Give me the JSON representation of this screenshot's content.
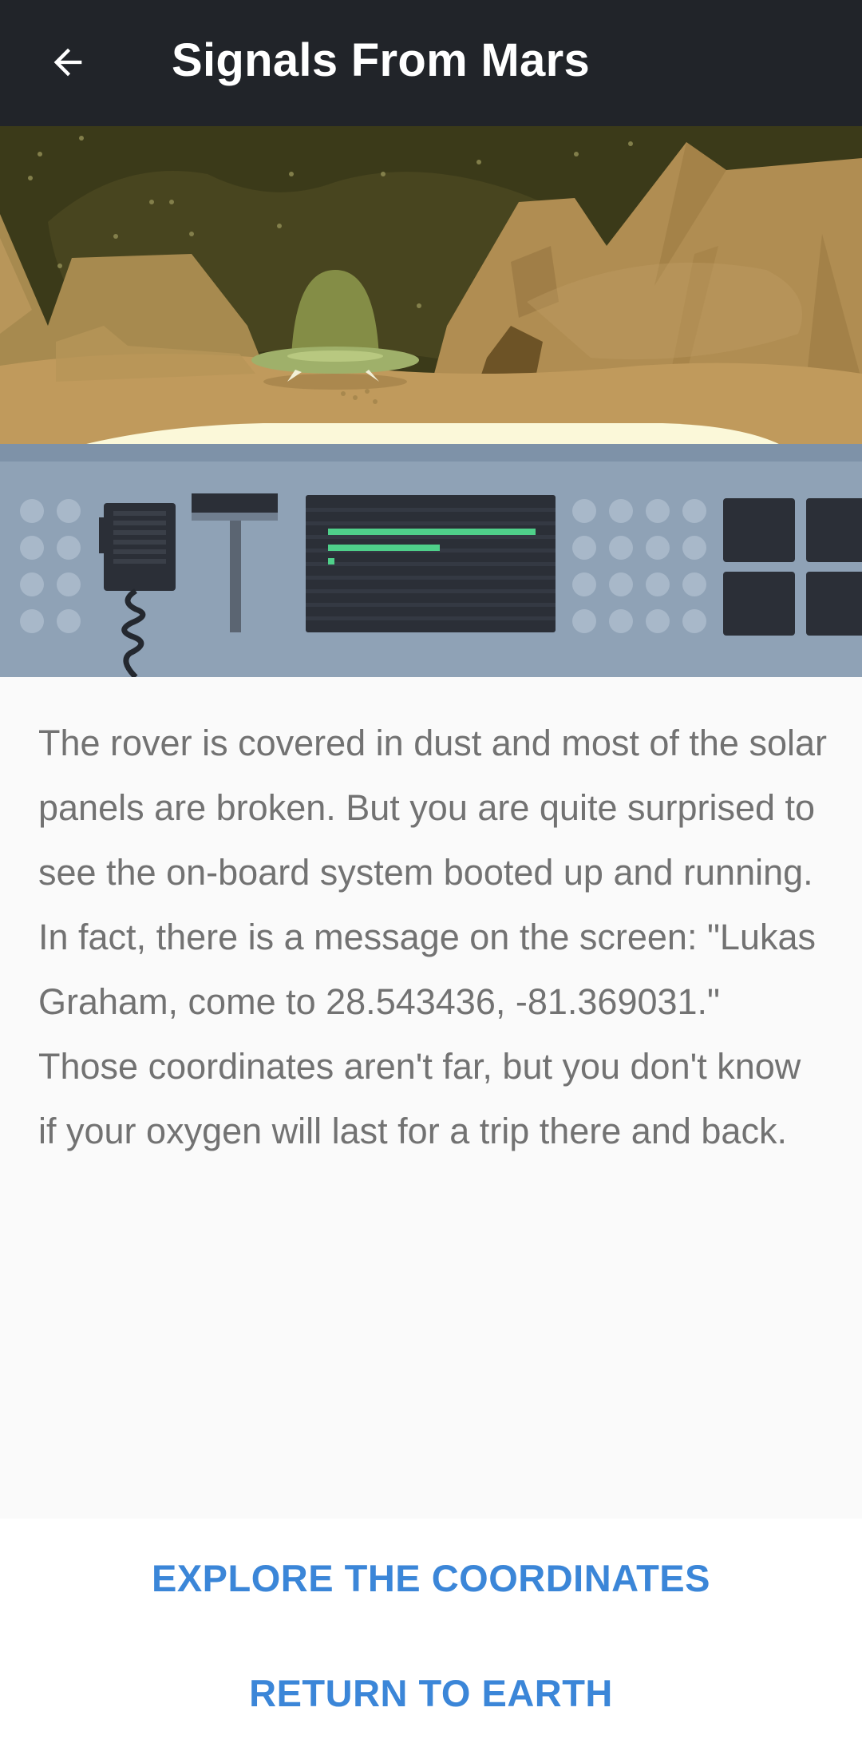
{
  "header": {
    "title": "Signals From Mars",
    "back_icon": "arrow-back-icon"
  },
  "story": {
    "text": "The rover is covered in dust and most of the solar panels are broken. But you are quite surprised to see the on-board system booted up and running. In fact, there is a message on the screen: \"Lukas Graham, come to 28.543436, -81.369031.\" Those coordinates aren't far, but you don't know if your oxygen will last for a trip there and back."
  },
  "actions": {
    "explore_label": "EXPLORE THE COORDINATES",
    "return_label": "RETURN TO EARTH"
  },
  "colors": {
    "app_bar": "#212429",
    "accent": "#3b86d8",
    "body_text": "#727272",
    "sky": "#3b3a19",
    "rock": "#b08d52",
    "console": "#8fa2b6"
  }
}
